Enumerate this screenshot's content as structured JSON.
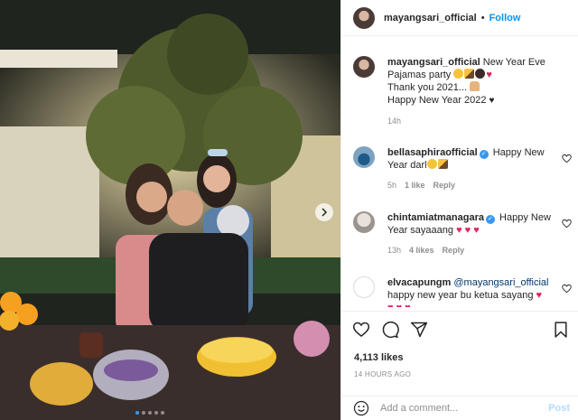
{
  "post": {
    "username": "mayangsari_official",
    "follow_label": "Follow",
    "separator": "•"
  },
  "caption": {
    "username": "mayangsari_official",
    "line1": "New Year Eve",
    "line2": "Pajamas party",
    "line3": "Thank you 2021...",
    "line4": "Happy New Year 2022",
    "time": "14h"
  },
  "comments": [
    {
      "username": "bellasaphiraofficial",
      "text_a": "Happy New",
      "text_b": "Year darl",
      "time": "5h",
      "likes": "1 like",
      "reply": "Reply"
    },
    {
      "username": "chintamiatmanagara",
      "text_a": "Happy New",
      "text_b": "Year sayaaang",
      "time": "13h",
      "likes": "4 likes",
      "reply": "Reply"
    },
    {
      "username": "elvacapungm",
      "mention": "@mayangsari_official",
      "text_b": "happy new year bu ketua sayang"
    }
  ],
  "actions": {
    "likes": "4,113 likes",
    "time": "14 HOURS AGO"
  },
  "composer": {
    "placeholder": "Add a comment...",
    "post_label": "Post"
  },
  "colors": {
    "accent": "#0095f6",
    "heart": "#e0245e"
  },
  "icons": [
    "heart-icon",
    "comment-icon",
    "share-icon",
    "bookmark-icon",
    "emoji-icon",
    "verified-icon",
    "chevron-right-icon"
  ]
}
